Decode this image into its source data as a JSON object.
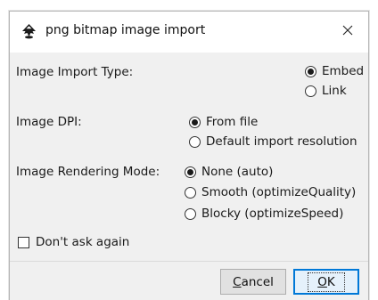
{
  "window": {
    "title": "png bitmap image import",
    "app_icon": "inkscape-logo-icon",
    "close_icon": "close-icon"
  },
  "import_type": {
    "label": "Image Import Type:",
    "options": [
      {
        "label": "Embed",
        "checked": true
      },
      {
        "label": "Link",
        "checked": false
      }
    ]
  },
  "dpi": {
    "label": "Image DPI:",
    "options": [
      {
        "label": "From file",
        "checked": true
      },
      {
        "label": "Default import resolution",
        "checked": false
      }
    ]
  },
  "rendering": {
    "label": "Image Rendering Mode:",
    "options": [
      {
        "label": "None (auto)",
        "checked": true
      },
      {
        "label": "Smooth (optimizeQuality)",
        "checked": false
      },
      {
        "label": "Blocky (optimizeSpeed)",
        "checked": false
      }
    ]
  },
  "dont_ask": {
    "label": "Don't ask again",
    "checked": false
  },
  "buttons": {
    "cancel_mnemonic": "C",
    "cancel_rest": "ancel",
    "ok_mnemonic": "O",
    "ok_rest": "K"
  },
  "colors": {
    "dialog_bg": "#f0f0f0",
    "title_bg": "#ffffff",
    "default_button_border": "#0078d7"
  }
}
